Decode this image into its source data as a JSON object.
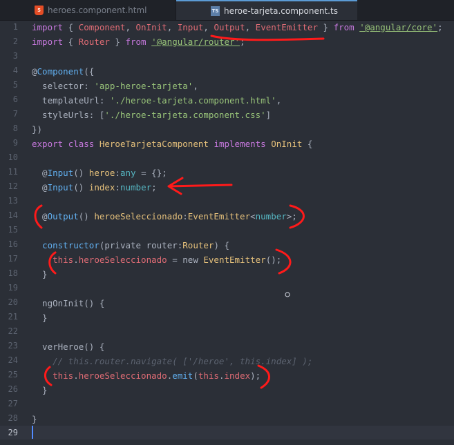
{
  "tabs": [
    {
      "label": "heroes.component.html",
      "icon": "html5-icon",
      "active": false
    },
    {
      "label": "heroe-tarjeta.component.ts",
      "icon": "typescript-icon",
      "active": true
    }
  ],
  "icons": {
    "html5": "5",
    "typescript": "TS"
  },
  "line_numbers": [
    "1",
    "2",
    "3",
    "4",
    "5",
    "6",
    "7",
    "8",
    "9",
    "10",
    "11",
    "12",
    "13",
    "14",
    "15",
    "16",
    "17",
    "18",
    "19",
    "20",
    "21",
    "22",
    "23",
    "24",
    "25",
    "26",
    "27",
    "28",
    "29"
  ],
  "code": {
    "l1": [
      "import",
      " { ",
      "Component",
      ", ",
      "OnInit",
      ", ",
      "Input",
      ", ",
      "Output",
      ", ",
      "EventEmitter",
      " } ",
      "from",
      " ",
      "'@angular/core'",
      ";"
    ],
    "l2": [
      "import",
      " { ",
      "Router",
      " } ",
      "from",
      " ",
      "'@angular/router'",
      ";"
    ],
    "l4": [
      "@",
      "Component",
      "({"
    ],
    "l5": [
      "  selector: ",
      "'app-heroe-tarjeta'",
      ","
    ],
    "l6": [
      "  templateUrl: ",
      "'./heroe-tarjeta.component.html'",
      ","
    ],
    "l7": [
      "  styleUrls: [",
      "'./heroe-tarjeta.component.css'",
      "]"
    ],
    "l8": [
      "})"
    ],
    "l9": [
      "export",
      " ",
      "class",
      " ",
      "HeroeTarjetaComponent",
      " ",
      "implements",
      " ",
      "OnInit",
      " {"
    ],
    "l11": [
      "  @",
      "Input",
      "() ",
      "heroe",
      ":",
      "any",
      " = {};"
    ],
    "l12": [
      "  @",
      "Input",
      "() ",
      "index",
      ":",
      "number",
      ";"
    ],
    "l14": [
      "  @",
      "Output",
      "() ",
      "heroeSeleccionado",
      ":",
      "EventEmitter",
      "<",
      "number",
      ">;"
    ],
    "l16": [
      "  ",
      "constructor",
      "(private router:",
      "Router",
      ") {"
    ],
    "l17": [
      "    ",
      "this",
      ".",
      "heroeSeleccionado",
      " = new ",
      "EventEmitter",
      "();"
    ],
    "l18": [
      "  }"
    ],
    "l20": [
      "  ngOnInit() {"
    ],
    "l21": [
      "  }"
    ],
    "l23": [
      "  verHeroe() {"
    ],
    "l24": [
      "    // this.router.navigate( ['/heroe', this.index] );"
    ],
    "l25": [
      "    ",
      "this",
      ".",
      "heroeSeleccionado",
      ".",
      "emit",
      "(",
      "this",
      ".",
      "index",
      ");"
    ],
    "l26": [
      "  }"
    ],
    "l28": [
      "}"
    ]
  }
}
